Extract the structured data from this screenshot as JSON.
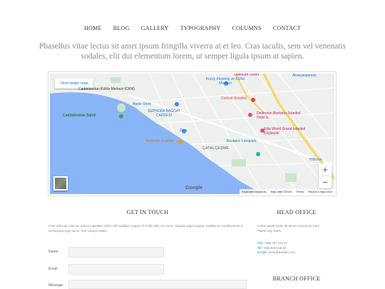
{
  "nav": {
    "items": [
      "HOME",
      "BLOG",
      "GALLERY",
      "TYPOGRAPHY",
      "COLUMNS",
      "CONTACT"
    ]
  },
  "tagline": "Phasellus vitae lectus sit amet ipsum fringilla viverra at et leo. Cras iaculis, sem vel venenatis sodales, elit dui elementum lorem, ut semper ligula ipsum at sapien.",
  "map": {
    "view_larger": "View larger map",
    "labels": {
      "caddebostan_kultur": "Caddebostan Kültür Merkezi (CKM)",
      "apple_store": "Apple Store",
      "caddebostan_sahili": "Caddebostan Sahili",
      "sephora": "SEPHORA BAĞDAT CADDESİ",
      "kozzy": "Kozzy Alışveriş ve Kültür Merkezi",
      "central_hospital": "Central Hospital",
      "dedeman": "Dedeman Bostancı İstanbul Hotel &...",
      "zara": "Zara",
      "westside": "Westside Suadiye",
      "lunapark": "Bostancı Lunapark",
      "catalcesme": "ÇATALÇEŞME",
      "elite": "Elite World Grand İstanbul Küçükyalı",
      "hilltown": "Hilltown",
      "optimum": "Optimum Outlet",
      "akasya": "Akasyaspienop"
    },
    "zoom_in": "+",
    "zoom_out": "−",
    "google": "Google",
    "attribution": [
      "Keyboard shortcuts",
      "Map data ©2023",
      "Terms",
      "Report a map error"
    ]
  },
  "get_in_touch": {
    "title": "GET IN TOUCH",
    "text": "Cras vehicula, enim ac rutrum imperdiet, tellus nibh sodales magna, id mollis odio mi a urna. Aliquam augue augue, sodales eu condimentum a, scelerisque eget purus. Sed suscipit mattis.",
    "fields": {
      "name": "Name",
      "email": "Email",
      "message": "Message"
    }
  },
  "head_office": {
    "title": "HEAD OFFICE",
    "address_line1": "Lorem Ipsum Dolor 89 Moon Avenue No 1121",
    "address_line2": "Planet City, Earth",
    "fax_label": "Fax:",
    "fax": "+555 797 534 01",
    "tel_label": "Tel:",
    "tel": "+555 636 646 62",
    "email_label": "E-mail:",
    "email": "name@domain.com"
  },
  "branch_office": {
    "title": "BRANCH OFFICE"
  },
  "colors": {
    "water": "#8ab4f8",
    "land": "#eef0ee",
    "park": "#c8e6c9",
    "highway": "#f9d66b",
    "link": "#1a73e8"
  }
}
